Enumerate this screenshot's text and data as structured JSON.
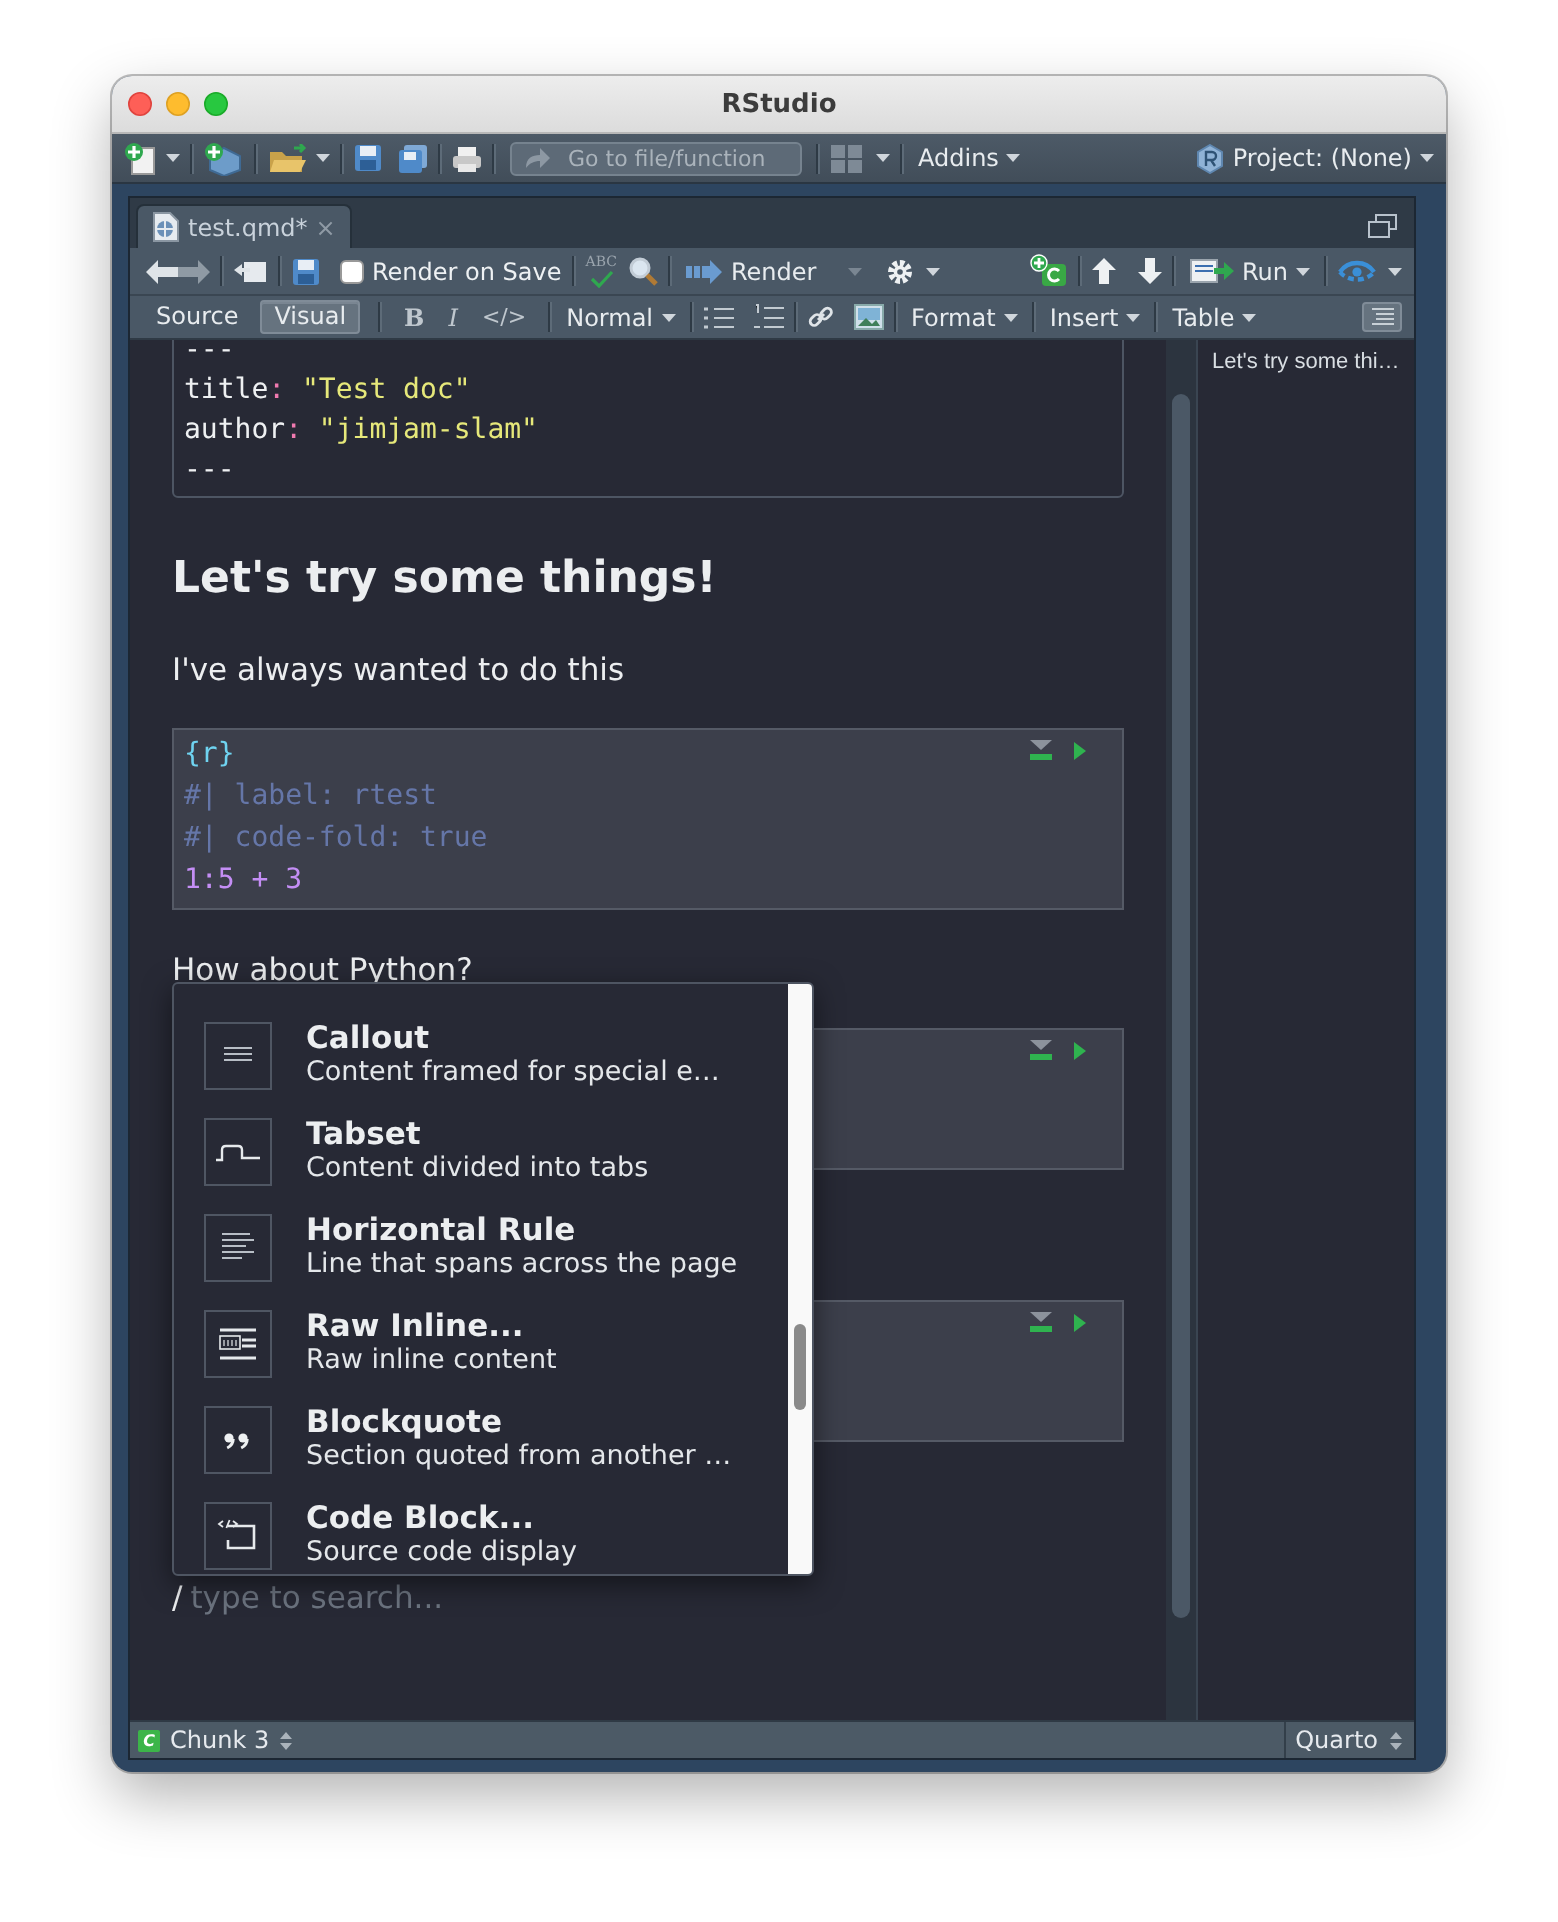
{
  "window": {
    "title": "RStudio"
  },
  "main_toolbar": {
    "goto_placeholder": "Go to file/function",
    "addins": "Addins",
    "project": "Project: (None)"
  },
  "editor_tabs": [
    {
      "label": "test.qmd*",
      "close": "×",
      "selected": true
    }
  ],
  "editor_toolbar": {
    "spellcheck": "ABC",
    "render_on_save": {
      "label": "Render on Save",
      "checked": false
    },
    "render": "Render",
    "run": "Run"
  },
  "format_toolbar": {
    "modes": [
      {
        "label": "Source",
        "selected": false
      },
      {
        "label": "Visual",
        "selected": true
      }
    ],
    "bold": "B",
    "italic": "I",
    "code": "</>",
    "block_style": "Normal",
    "menus": [
      "Format",
      "Insert",
      "Table"
    ]
  },
  "document": {
    "blocks": [
      {
        "kind": "yaml",
        "lines": [
          {
            "kind": "delimiter",
            "text": "---"
          },
          {
            "kind": "field",
            "key": "title",
            "sep": ":",
            "value": "\"Test doc\""
          },
          {
            "kind": "field",
            "key": "author",
            "sep": ":",
            "value": "\"jimjam-slam\""
          },
          {
            "kind": "delimiter",
            "text": "---"
          }
        ]
      },
      {
        "kind": "heading",
        "text": "Let's try some things!"
      },
      {
        "kind": "paragraph",
        "text": "I've always wanted to do this"
      },
      {
        "kind": "chunk",
        "lines": [
          {
            "kind": "header",
            "text": "{r}"
          },
          {
            "kind": "option",
            "text": "#| label: rtest"
          },
          {
            "kind": "option",
            "text": "#| code-fold: true"
          },
          {
            "kind": "code",
            "text": "1:5 + 3"
          }
        ]
      },
      {
        "kind": "paragraph",
        "text": "How about Python?"
      },
      {
        "kind": "chunk"
      },
      {
        "kind": "chunk"
      }
    ],
    "slash_search": {
      "prefix": "/",
      "placeholder": "type to search..."
    }
  },
  "insert_menu": {
    "items": [
      {
        "kind": "callout",
        "title": "Callout",
        "description": "Content framed for special e…"
      },
      {
        "kind": "tabset",
        "title": "Tabset",
        "description": "Content divided into tabs"
      },
      {
        "kind": "rule",
        "title": "Horizontal Rule",
        "description": "Line that spans across the page"
      },
      {
        "kind": "raw",
        "title": "Raw Inline...",
        "description": "Raw inline content"
      },
      {
        "kind": "quote",
        "title": "Blockquote",
        "description": "Section quoted from another …"
      },
      {
        "kind": "code",
        "title": "Code Block...",
        "description": "Source code display"
      }
    ]
  },
  "outline": {
    "items": [
      "Let's try some thi…"
    ]
  },
  "status_bar": {
    "badge": "C",
    "position": "Chunk 3",
    "mode": "Quarto"
  }
}
